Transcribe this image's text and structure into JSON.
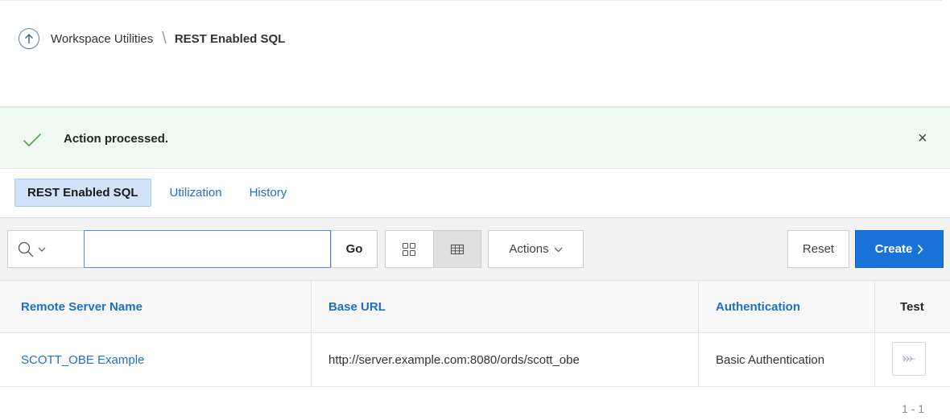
{
  "breadcrumb": {
    "parent": "Workspace Utilities",
    "separator": "\\",
    "current": "REST Enabled SQL"
  },
  "alert": {
    "message": "Action processed.",
    "close_label": "×"
  },
  "tabs": [
    {
      "label": "REST Enabled SQL",
      "active": true
    },
    {
      "label": "Utilization",
      "active": false
    },
    {
      "label": "History",
      "active": false
    }
  ],
  "toolbar": {
    "search_value": "",
    "go_label": "Go",
    "actions_label": "Actions",
    "reset_label": "Reset",
    "create_label": "Create"
  },
  "table": {
    "columns": [
      "Remote Server Name",
      "Base URL",
      "Authentication",
      "Test"
    ],
    "rows": [
      {
        "name": "SCOTT_OBE Example",
        "base_url": "http://server.example.com:8080/ords/scott_obe",
        "authentication": "Basic Authentication"
      }
    ]
  },
  "pagination": "1 - 1",
  "colors": {
    "accent": "#1a73d9",
    "link": "#1f6fc7",
    "alert_bg": "#eff8f1",
    "success": "#3fb950"
  },
  "icons": {
    "up": "arrow-up-circle-icon",
    "success": "check-icon",
    "search": "search-icon",
    "grid_view": "grid-view-icon",
    "report_view": "table-view-icon",
    "test": "connection-test-icon"
  }
}
